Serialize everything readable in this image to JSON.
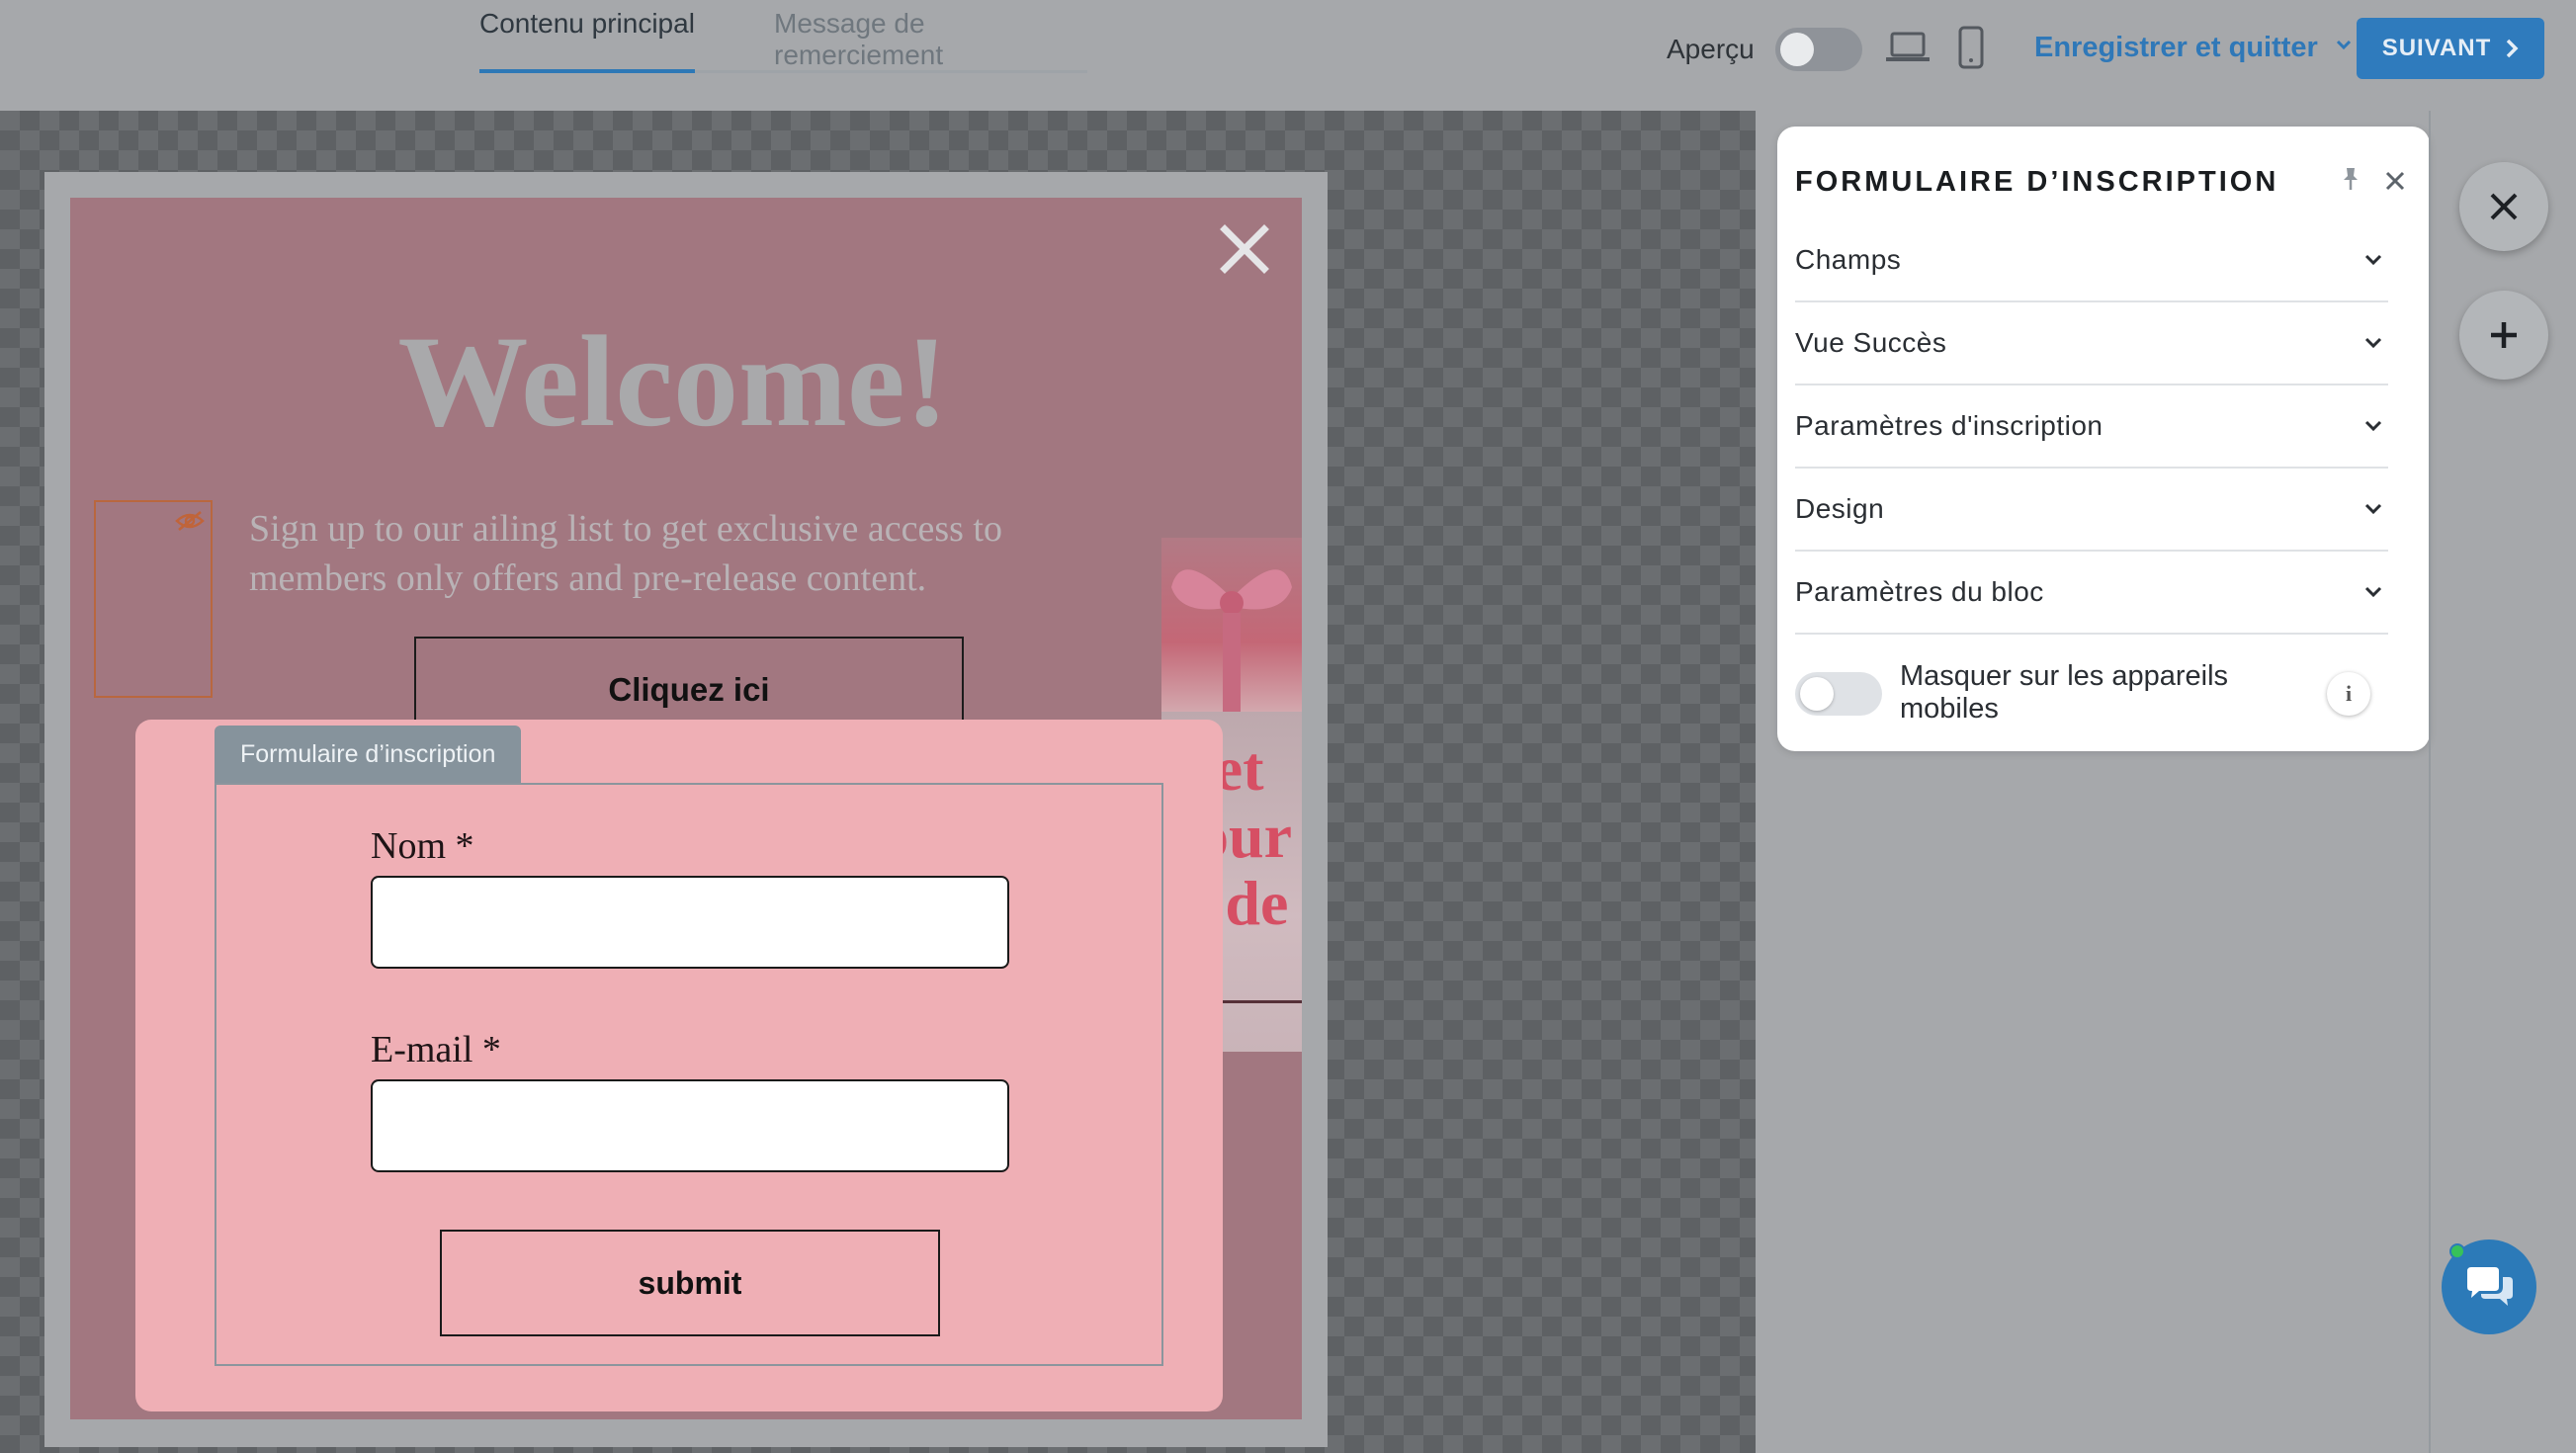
{
  "tabs": [
    {
      "label": "Contenu principal",
      "active": true
    },
    {
      "label": "Message de remerciement",
      "active": false
    }
  ],
  "toolbar": {
    "preview_label": "Aperçu",
    "preview_on": false,
    "devices": [
      "laptop-icon",
      "mobile-icon"
    ],
    "save_quit_label": "Enregistrer et quitter",
    "next_label": "SUIVANT"
  },
  "popup": {
    "title": "Welcome!",
    "intro": "Sign up to our ailing list to get exclusive access to members only offers and pre-release content.",
    "button_label": "Cliquez ici",
    "gift_text": "Get your code",
    "form": {
      "tag_label": "Formulaire d’inscription",
      "fields": [
        {
          "label": "Nom *",
          "value": ""
        },
        {
          "label": "E-mail *",
          "value": ""
        }
      ],
      "submit_label": "submit"
    }
  },
  "panel": {
    "title": "FORMULAIRE D’INSCRIPTION",
    "sections": [
      {
        "label": "Champs"
      },
      {
        "label": "Vue Succès"
      },
      {
        "label": "Paramètres d'inscription"
      },
      {
        "label": "Design"
      },
      {
        "label": "Paramètres du bloc"
      }
    ],
    "hide_mobile_label": "Masquer sur les appareils mobiles",
    "hide_mobile_on": false,
    "info_label": "i"
  },
  "colors": {
    "accent": "#2f7bbd",
    "popup_bg": "#a27780",
    "form_bg": "#efafb5",
    "gift_text": "#d64f64"
  }
}
